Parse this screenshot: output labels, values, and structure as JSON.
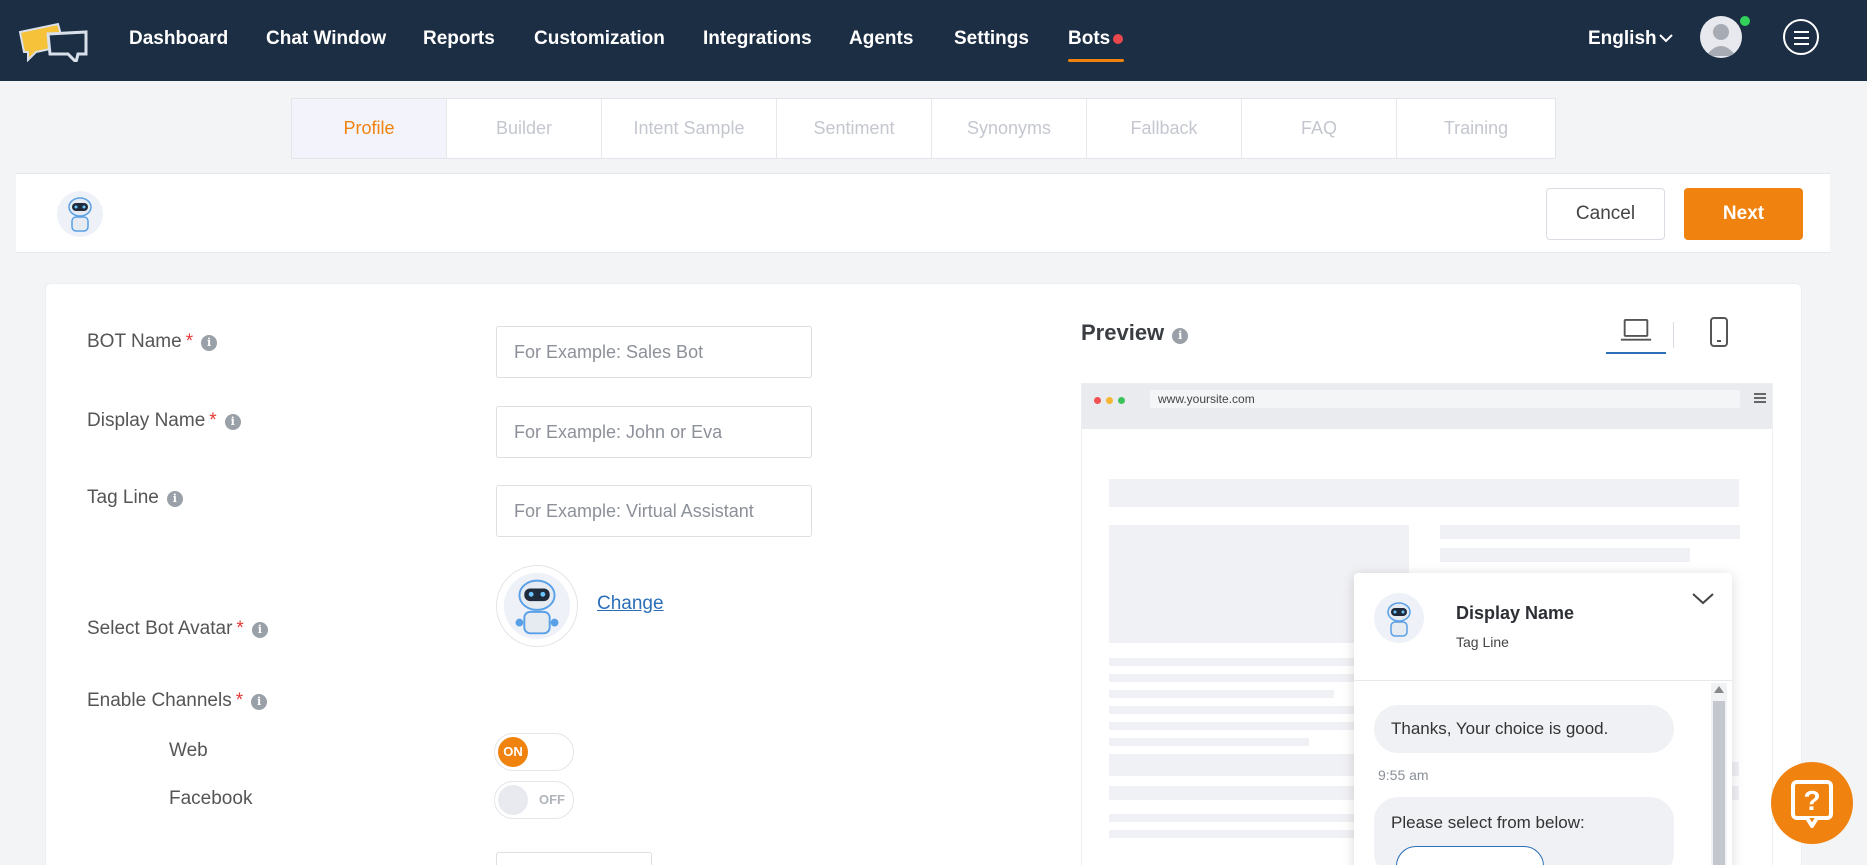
{
  "nav": {
    "items": [
      "Dashboard",
      "Chat Window",
      "Reports",
      "Customization",
      "Integrations",
      "Agents",
      "Settings",
      "Bots"
    ],
    "active": "Bots",
    "language": "English",
    "accent_color": "#f0820f",
    "bar_color": "#1c2e44"
  },
  "tabs": {
    "items": [
      "Profile",
      "Builder",
      "Intent Sample",
      "Sentiment",
      "Synonyms",
      "Fallback",
      "FAQ",
      "Training"
    ],
    "active": "Profile"
  },
  "actions": {
    "cancel": "Cancel",
    "next": "Next"
  },
  "form": {
    "bot_name": {
      "label": "BOT Name",
      "placeholder": "For Example: Sales Bot"
    },
    "display_name": {
      "label": "Display Name",
      "placeholder": "For Example: John or Eva"
    },
    "tag_line": {
      "label": "Tag Line",
      "placeholder": "For Example: Virtual Assistant"
    },
    "avatar": {
      "label": "Select Bot Avatar",
      "change": "Change"
    },
    "channels": {
      "label": "Enable Channels",
      "web": {
        "label": "Web",
        "state": "ON"
      },
      "facebook": {
        "label": "Facebook",
        "state": "OFF"
      }
    },
    "required_marker": "*"
  },
  "preview": {
    "title": "Preview",
    "url": "www.yoursite.com",
    "chat": {
      "name": "Display Name",
      "tagline": "Tag Line",
      "message1": "Thanks, Your choice is good.",
      "time": "9:55 am",
      "message2": "Please select from below:"
    }
  },
  "icons": {
    "logo": "chat-bubbles-logo",
    "info": "info-icon",
    "laptop": "laptop-icon",
    "phone": "phone-icon",
    "help": "help-question-icon"
  }
}
